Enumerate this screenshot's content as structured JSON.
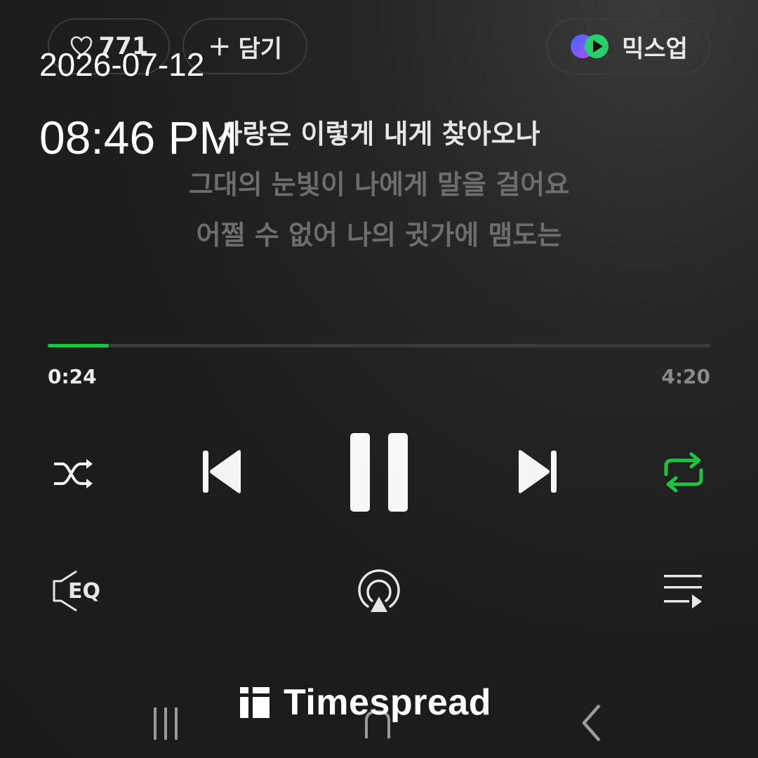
{
  "overlay": {
    "date": "2026-07-12",
    "time": "08:46 PM"
  },
  "top": {
    "like_count": "771",
    "add_label": "담기",
    "mixup_label": "믹스업"
  },
  "lyrics": [
    "사랑은 이렇게 내게 찾아오나",
    "그대의 눈빛이 나에게 말을 걸어요",
    "어쩔 수 없어 나의 귓가에 맴도는"
  ],
  "progress": {
    "elapsed": "0:24",
    "total": "4:20",
    "fraction": 0.0923
  },
  "controls": {
    "shuffle": "shuffle-icon",
    "previous": "previous-icon",
    "play_state": "pause-icon",
    "next": "next-icon",
    "repeat": "repeat-icon"
  },
  "secondary": {
    "eq_label": "EQ",
    "cast": "cast-icon",
    "playlist": "playlist-icon"
  },
  "colors": {
    "accent": "#1ec441",
    "inactive_lyric": "#6d6d6d"
  },
  "watermark": {
    "brand": "Timespread"
  }
}
